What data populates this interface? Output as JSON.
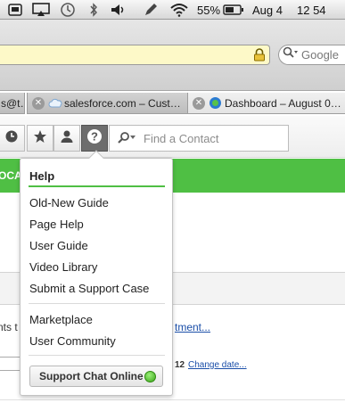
{
  "menubar": {
    "battery_percent": "55%",
    "date": "Aug 4",
    "time": "12 54"
  },
  "browser": {
    "search_placeholder": "Google",
    "tabs": [
      {
        "label": "s@t…"
      },
      {
        "label": "salesforce.com – Cust…"
      },
      {
        "label": "Dashboard – August 0…"
      }
    ]
  },
  "sf_header": {
    "find_contact_placeholder": "Find a Contact"
  },
  "background_page": {
    "green_band_text": "OCA",
    "text_fragment": "nts t",
    "link_fragment": "tment...",
    "date_number": "12",
    "change_date_link": "Change date..."
  },
  "help_menu": {
    "title": "Help",
    "group_1": [
      "Old-New Guide",
      "Page Help",
      "User Guide",
      "Video Library",
      "Submit a Support Case"
    ],
    "group_2": [
      "Marketplace",
      "User Community"
    ],
    "support_chat_label": "Support Chat Online",
    "support_chat_status_color": "#3aa519"
  },
  "colors": {
    "accent_green": "#4fbf44",
    "link_blue": "#1a4ea8",
    "url_bar_yellow": "#fdf9c8"
  }
}
